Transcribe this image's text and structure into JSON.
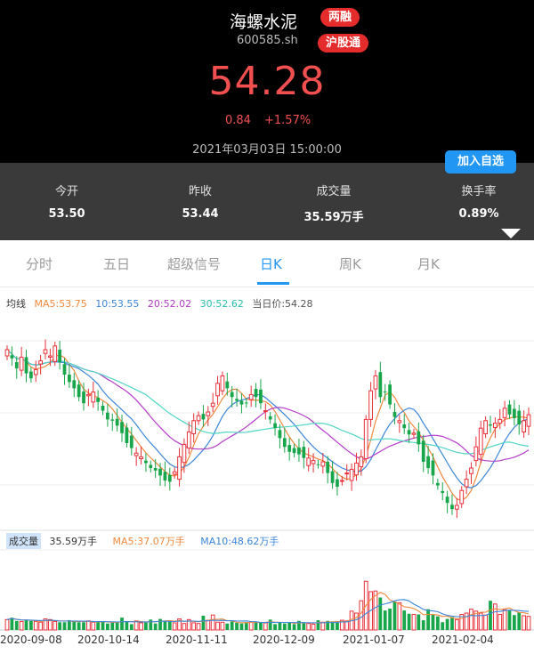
{
  "stock": {
    "name": "海螺水泥",
    "code": "600585.sh",
    "badges": [
      "两融",
      "沪股通"
    ],
    "price": "54.28",
    "change": "0.84",
    "change_pct": "+1.57%",
    "timestamp": "2021年03月03日 15:00:00"
  },
  "watch_button": "加入自选",
  "stats": [
    {
      "label": "今开",
      "value": "53.50"
    },
    {
      "label": "昨收",
      "value": "53.44"
    },
    {
      "label": "成交量",
      "value": "35.59万手"
    },
    {
      "label": "换手率",
      "value": "0.89%"
    }
  ],
  "tabs": [
    {
      "label": "分时"
    },
    {
      "label": "五日"
    },
    {
      "label": "超级信号"
    },
    {
      "label": "日K",
      "active": true
    },
    {
      "label": "周K"
    },
    {
      "label": "月K"
    }
  ],
  "ma_legend": {
    "title": "均线",
    "ma5": "MA5:53.75",
    "ma10": "10:53.55",
    "ma20": "20:52.02",
    "ma30": "30:52.62",
    "current": "当日价:54.28"
  },
  "volume_legend": {
    "title": "成交量",
    "value": "35.59万手",
    "ma5": "MA5:37.07万手",
    "ma10": "MA10:48.62万手"
  },
  "colors": {
    "up": "#e8313a",
    "down": "#18a64a",
    "ma5": "#f0883d",
    "ma10": "#3c86d9",
    "ma20": "#b43cc8",
    "ma30": "#4fd6c6",
    "accent": "#2196f3"
  },
  "chart_data": {
    "type": "candlestick",
    "x_tick_labels": [
      "2020-09-08",
      "2020-10-14",
      "2020-11-11",
      "2020-12-09",
      "2021-01-07",
      "2021-02-04"
    ],
    "price_range": [
      46,
      62
    ],
    "closes": [
      59.5,
      58.8,
      58.0,
      58.9,
      57.6,
      57.2,
      57.9,
      58.6,
      59.5,
      59.0,
      59.8,
      58.5,
      57.5,
      56.9,
      56.4,
      55.7,
      55.2,
      55.9,
      56.1,
      55.3,
      54.6,
      53.9,
      53.8,
      53.4,
      52.8,
      52.0,
      51.6,
      51.2,
      50.9,
      50.4,
      50.0,
      49.8,
      49.4,
      49.0,
      48.9,
      49.7,
      50.9,
      51.9,
      52.9,
      53.8,
      54.2,
      53.9,
      54.5,
      55.2,
      56.8,
      57.4,
      56.4,
      55.7,
      55.4,
      55.1,
      55.2,
      55.9,
      55.7,
      55.2,
      54.6,
      53.9,
      53.2,
      52.4,
      51.7,
      51.3,
      51.2,
      51.1,
      50.8,
      50.8,
      50.6,
      50.3,
      50.5,
      49.6,
      48.8,
      48.5,
      49.0,
      49.6,
      49.9,
      50.4,
      50.9,
      53.9,
      56.2,
      57.4,
      55.7,
      56.1,
      55.1,
      54.1,
      53.8,
      53.2,
      52.7,
      52.8,
      51.9,
      50.5,
      50.0,
      49.4,
      48.6,
      48.0,
      47.2,
      46.7,
      47.0,
      48.2,
      49.1,
      50.0,
      51.7,
      53.2,
      53.8,
      53.4,
      53.6,
      53.9,
      54.8,
      54.3,
      54.0,
      53.5,
      53.8,
      54.28
    ],
    "ma5_last": 53.75,
    "ma10_last": 53.55,
    "ma20_last": 52.02,
    "ma30_last": 52.62,
    "volume_range": [
      0,
      1
    ],
    "volumes": [
      0.16,
      0.19,
      0.14,
      0.13,
      0.15,
      0.14,
      0.13,
      0.12,
      0.17,
      0.16,
      0.13,
      0.12,
      0.12,
      0.15,
      0.14,
      0.12,
      0.12,
      0.14,
      0.12,
      0.13,
      0.13,
      0.1,
      0.11,
      0.12,
      0.19,
      0.13,
      0.09,
      0.14,
      0.11,
      0.13,
      0.16,
      0.1,
      0.17,
      0.14,
      0.15,
      0.11,
      0.17,
      0.1,
      0.16,
      0.11,
      0.1,
      0.22,
      0.15,
      0.23,
      0.12,
      0.12,
      0.1,
      0.13,
      0.11,
      0.1,
      0.12,
      0.12,
      0.13,
      0.11,
      0.11,
      0.16,
      0.09,
      0.12,
      0.1,
      0.11,
      0.09,
      0.14,
      0.11,
      0.1,
      0.09,
      0.15,
      0.12,
      0.14,
      0.13,
      0.11,
      0.15,
      0.14,
      0.29,
      0.26,
      0.45,
      0.75,
      0.59,
      0.6,
      0.5,
      0.3,
      0.33,
      0.44,
      0.42,
      0.3,
      0.25,
      0.24,
      0.24,
      0.15,
      0.32,
      0.24,
      0.21,
      0.12,
      0.17,
      0.2,
      0.16,
      0.24,
      0.26,
      0.32,
      0.29,
      0.26,
      0.23,
      0.45,
      0.4,
      0.24,
      0.31,
      0.3,
      0.23,
      0.27,
      0.22,
      0.21
    ]
  }
}
